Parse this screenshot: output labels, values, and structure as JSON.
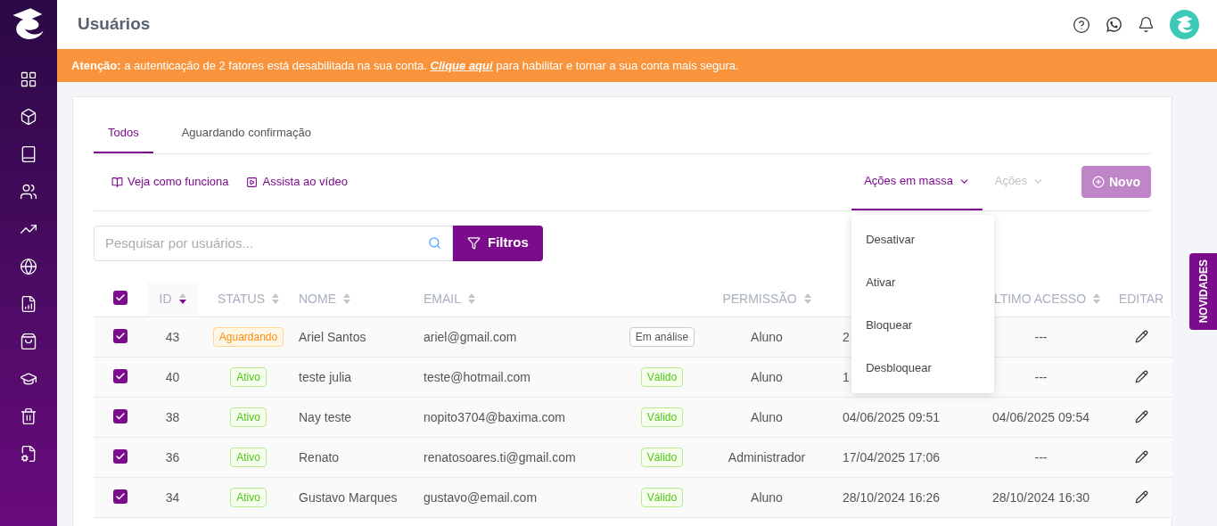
{
  "header": {
    "title": "Usuários"
  },
  "banner": {
    "text": "**Atenção:** a autenticação de 2 fatores está desabilitada na sua conta.",
    "link": "Clique aqui",
    "rest": "para habilitar e tornar a sua conta mais segura."
  },
  "tabs": [
    {
      "label": "Todos",
      "selected": true
    },
    {
      "label": "Aguardando confirmação",
      "selected": false
    }
  ],
  "help_links": [
    {
      "label": "Veja como funciona",
      "kind": "book"
    },
    {
      "label": "Assista ao vídeo",
      "kind": "video"
    }
  ],
  "actions": [
    {
      "label": "Ações em massa",
      "disabled": false,
      "expanded": true
    },
    {
      "label": "Ações",
      "disabled": true,
      "expanded": false
    }
  ],
  "new_button": {
    "label": "Novo",
    "disabled": true
  },
  "search": {
    "placeholder": "Pesquisar por usuários..."
  },
  "filter_button": {
    "label": "Filtros"
  },
  "menu": [
    "Desativar",
    "Ativar",
    "Bloquear",
    "Desbloquear"
  ],
  "table": {
    "all_checked": true,
    "columns": [
      {
        "kind": "sort",
        "label": "ID",
        "sorted": true
      },
      {
        "kind": "sort",
        "label": "STATUS",
        "sorted": false
      },
      {
        "kind": "sort",
        "label": "NOME",
        "sorted": false
      },
      {
        "kind": "sort",
        "label": "EMAIL",
        "sorted": false
      },
      {
        "kind": "blank"
      },
      {
        "kind": "sort",
        "label": "PERMISSÃO",
        "sorted": false
      },
      {
        "kind": "blank"
      },
      {
        "kind": "sort",
        "label": "LTIMO ACESSO",
        "sorted": false
      },
      {
        "kind": "plain",
        "label": "EDITAR"
      }
    ],
    "rows": [
      {
        "checked": true,
        "id": "43",
        "status": {
          "label": "Aguardando",
          "kind": "pending"
        },
        "name": "Ariel Santos",
        "email": "ariel@gmail.com",
        "verification": {
          "label": "Em análise",
          "kind": "review"
        },
        "permission": "Aluno",
        "created": "2",
        "last_access": "---"
      },
      {
        "checked": true,
        "id": "40",
        "status": {
          "label": "Ativo",
          "kind": "active"
        },
        "name": "teste julia",
        "email": "teste@hotmail.com",
        "verification": {
          "label": "Válido",
          "kind": "valid"
        },
        "permission": "Aluno",
        "created": "1",
        "last_access": "---"
      },
      {
        "checked": true,
        "id": "38",
        "status": {
          "label": "Ativo",
          "kind": "active"
        },
        "name": "Nay teste",
        "email": "nopito3704@baxima.com",
        "verification": {
          "label": "Válido",
          "kind": "valid"
        },
        "permission": "Aluno",
        "created": "04/06/2025 09:51",
        "last_access": "04/06/2025 09:54"
      },
      {
        "checked": true,
        "id": "36",
        "status": {
          "label": "Ativo",
          "kind": "active"
        },
        "name": "Renato",
        "email": "renatosoares.ti@gmail.com",
        "verification": {
          "label": "Válido",
          "kind": "valid"
        },
        "permission": "Administrador",
        "created": "17/04/2025 17:06",
        "last_access": "---"
      },
      {
        "checked": true,
        "id": "34",
        "status": {
          "label": "Ativo",
          "kind": "active"
        },
        "name": "Gustavo Marques",
        "email": "gustavo@email.com",
        "verification": {
          "label": "Válido",
          "kind": "valid"
        },
        "permission": "Aluno",
        "created": "28/10/2024 16:26",
        "last_access": "28/10/2024 16:30"
      }
    ]
  },
  "side_tab": {
    "label": "NOVIDADES"
  }
}
